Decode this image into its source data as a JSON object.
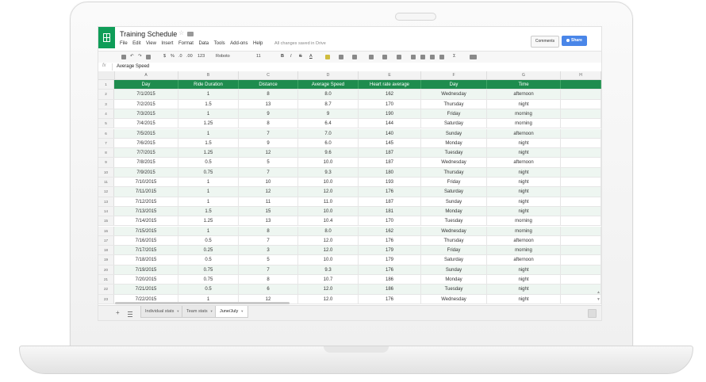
{
  "app": {
    "title": "Training Schedule",
    "save_status": "All changes saved in Drive",
    "comments_label": "Comments",
    "share_label": "Share"
  },
  "menu": [
    "File",
    "Edit",
    "View",
    "Insert",
    "Format",
    "Data",
    "Tools",
    "Add-ons",
    "Help"
  ],
  "toolbar": {
    "currency": "$",
    "percent": "%",
    "decimal_less": ".0",
    "decimal_more": ".00",
    "number_format": "123",
    "font": "Roboto",
    "font_size": "11",
    "bold": "B",
    "italic": "I",
    "strikethrough": "S",
    "text_color": "A"
  },
  "formula_bar": {
    "fx_label": "fx",
    "value": "Average Speed"
  },
  "columns": [
    "A",
    "B",
    "C",
    "D",
    "E",
    "F",
    "G",
    "H"
  ],
  "header_row": [
    "Day",
    "Ride Duration",
    "Distance",
    "Average Speed",
    "Heart rate average",
    "Day",
    "Time"
  ],
  "rows": [
    [
      "7/1/2015",
      "1",
      "8",
      "8.0",
      "162",
      "Wednesday",
      "afternoon"
    ],
    [
      "7/2/2015",
      "1.5",
      "13",
      "8.7",
      "170",
      "Thursday",
      "night"
    ],
    [
      "7/3/2015",
      "1",
      "9",
      "9",
      "190",
      "Friday",
      "morning"
    ],
    [
      "7/4/2015",
      "1.25",
      "8",
      "6.4",
      "144",
      "Saturday",
      "morning"
    ],
    [
      "7/5/2015",
      "1",
      "7",
      "7.0",
      "140",
      "Sunday",
      "afternoon"
    ],
    [
      "7/6/2015",
      "1.5",
      "9",
      "6.0",
      "145",
      "Monday",
      "night"
    ],
    [
      "7/7/2015",
      "1.25",
      "12",
      "9.6",
      "187",
      "Tuesday",
      "night"
    ],
    [
      "7/8/2015",
      "0.5",
      "5",
      "10.0",
      "187",
      "Wednesday",
      "afternoon"
    ],
    [
      "7/9/2015",
      "0.75",
      "7",
      "9.3",
      "180",
      "Thursday",
      "night"
    ],
    [
      "7/10/2015",
      "1",
      "10",
      "10.0",
      "193",
      "Friday",
      "night"
    ],
    [
      "7/11/2015",
      "1",
      "12",
      "12.0",
      "176",
      "Saturday",
      "night"
    ],
    [
      "7/12/2015",
      "1",
      "11",
      "11.0",
      "187",
      "Sunday",
      "night"
    ],
    [
      "7/13/2015",
      "1.5",
      "15",
      "10.0",
      "181",
      "Monday",
      "night"
    ],
    [
      "7/14/2015",
      "1.25",
      "13",
      "10.4",
      "170",
      "Tuesday",
      "morning"
    ],
    [
      "7/15/2015",
      "1",
      "8",
      "8.0",
      "162",
      "Wednesday",
      "morning"
    ],
    [
      "7/16/2015",
      "0.5",
      "7",
      "12.0",
      "176",
      "Thursday",
      "afternoon"
    ],
    [
      "7/17/2015",
      "0.25",
      "3",
      "12.0",
      "179",
      "Friday",
      "morning"
    ],
    [
      "7/18/2015",
      "0.5",
      "5",
      "10.0",
      "179",
      "Saturday",
      "afternoon"
    ],
    [
      "7/19/2015",
      "0.75",
      "7",
      "9.3",
      "176",
      "Sunday",
      "night"
    ],
    [
      "7/20/2015",
      "0.75",
      "8",
      "10.7",
      "186",
      "Monday",
      "night"
    ],
    [
      "7/21/2015",
      "0.5",
      "6",
      "12.0",
      "186",
      "Tuesday",
      "night"
    ],
    [
      "7/22/2015",
      "1",
      "12",
      "12.0",
      "176",
      "Wednesday",
      "night"
    ]
  ],
  "sheet_tabs": [
    {
      "label": "Individual stats",
      "active": false
    },
    {
      "label": "Team stats",
      "active": false
    },
    {
      "label": "June/July",
      "active": true
    }
  ],
  "colors": {
    "header_green": "#1e8c4e",
    "logo_green": "#0f9d58",
    "share_blue": "#4a86e8",
    "band_green": "#eef6f1"
  }
}
